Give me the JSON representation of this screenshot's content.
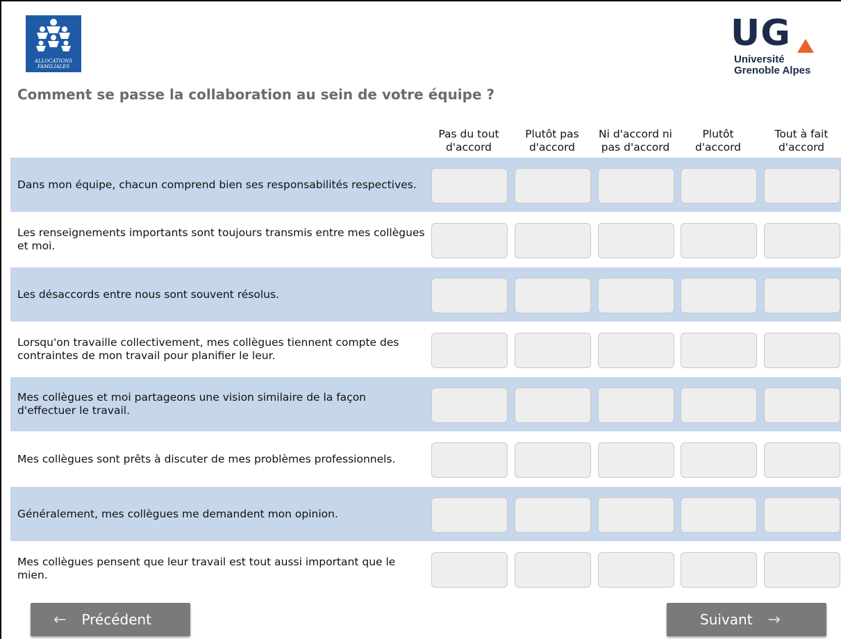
{
  "logos": {
    "caf": {
      "line1": "ALLOCATIONS",
      "line2": "FAMILIALES",
      "color": "#1f5aa6"
    },
    "uga": {
      "letters": "UG",
      "line1": "Université",
      "line2": "Grenoble Alpes",
      "text_color": "#1c2b4a",
      "accent_color": "#e8632a"
    }
  },
  "question": {
    "title": "Comment se passe la collaboration au sein de votre équipe ?"
  },
  "columns": [
    {
      "label": "Pas du tout d'accord"
    },
    {
      "label": "Plutôt pas d'accord"
    },
    {
      "label": "Ni d'accord ni pas d'accord"
    },
    {
      "label": "Plutôt d'accord"
    },
    {
      "label": "Tout à fait d'accord"
    }
  ],
  "rows": [
    {
      "label": "Dans mon équipe, chacun comprend bien ses responsabilités respectives."
    },
    {
      "label": "Les renseignements importants sont toujours transmis entre mes collègues et moi."
    },
    {
      "label": "Les désaccords entre nous sont souvent résolus."
    },
    {
      "label": "Lorsqu'on travaille collectivement, mes collègues tiennent compte des contraintes de mon travail pour planifier le leur."
    },
    {
      "label": "Mes collègues et moi partageons une vision similaire de la façon d'effectuer le travail."
    },
    {
      "label": "Mes collègues sont prêts à discuter de mes problèmes professionnels."
    },
    {
      "label": "Généralement, mes collègues me demandent mon opinion."
    },
    {
      "label": "Mes collègues pensent que leur travail est tout aussi important que le mien."
    }
  ],
  "navigation": {
    "previous_label": "Précédent",
    "previous_icon": "arrow-left-icon",
    "next_label": "Suivant",
    "next_icon": "arrow-right-icon"
  },
  "colors": {
    "row_shade": "#c6d6eb",
    "choice_bg": "#eeeeee",
    "button_bg": "#7a7a7a",
    "title_color": "#6b6b6b"
  }
}
